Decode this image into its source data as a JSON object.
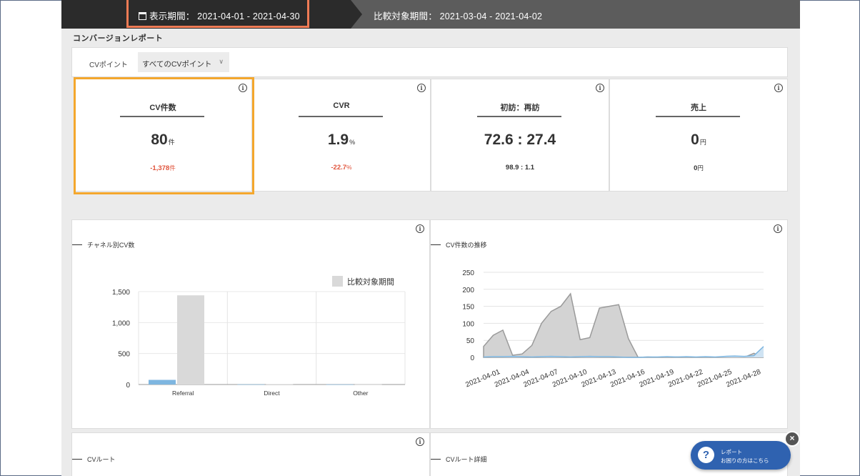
{
  "header": {
    "display_period": "表示期間： 2021-04-01 - 2021-04-30",
    "comparison_period": "比較対象期間： 2021-03-04 - 2021-04-02"
  },
  "page_title": "コンバージョンレポート",
  "filter": {
    "label": "CVポイント",
    "selected": "すべてのCVポイント"
  },
  "metrics": [
    {
      "label": "CV件数",
      "value": "80",
      "unit": "件",
      "diff": "-1,378",
      "diff_unit": "件",
      "diff_negative": true
    },
    {
      "label": "CVR",
      "value": "1.9",
      "unit": "%",
      "diff": "-22.7",
      "diff_unit": "%",
      "diff_negative": true
    },
    {
      "label": "初訪：再訪",
      "value": "72.6 : 27.4",
      "unit": "",
      "diff": "98.9 : 1.1",
      "diff_unit": "",
      "diff_negative": false
    },
    {
      "label": "売上",
      "value": "0",
      "unit": "円",
      "diff": "0",
      "diff_unit": "円",
      "diff_negative": false
    }
  ],
  "panels": {
    "channel_title": "チャネル別CV数",
    "trend_title": "CV件数の推移",
    "route_title": "CVルート",
    "route_detail_title": "CVルート詳細"
  },
  "help_button": {
    "line1": "レポート",
    "line2": "お困りの方はこちら"
  },
  "colors": {
    "current": "#7eb6e0",
    "comparison": "#d9d9d9",
    "negative": "#e0533b",
    "highlight_orange": "#f4a72d",
    "highlight_red": "#ef7b55"
  },
  "chart_data": [
    {
      "type": "bar",
      "categories": [
        "Referral",
        "Direct",
        "Other"
      ],
      "series": [
        {
          "values": [
            75,
            3,
            2
          ]
        },
        {
          "name": "比較対象期間",
          "values": [
            1440,
            5,
            3
          ]
        }
      ],
      "yticks": [
        "0",
        "500",
        "1,000",
        "1,500"
      ],
      "ylim": [
        0,
        1500
      ],
      "legend": "top-right"
    },
    {
      "type": "area",
      "x": [
        "2021-04-01",
        "2021-04-02",
        "2021-04-03",
        "2021-04-04",
        "2021-04-05",
        "2021-04-06",
        "2021-04-07",
        "2021-04-08",
        "2021-04-09",
        "2021-04-10",
        "2021-04-11",
        "2021-04-12",
        "2021-04-13",
        "2021-04-14",
        "2021-04-15",
        "2021-04-16",
        "2021-04-17",
        "2021-04-18",
        "2021-04-19",
        "2021-04-20",
        "2021-04-21",
        "2021-04-22",
        "2021-04-23",
        "2021-04-24",
        "2021-04-25",
        "2021-04-26",
        "2021-04-27",
        "2021-04-28",
        "2021-04-29",
        "2021-04-30"
      ],
      "xticks": [
        "2021-04-01",
        "2021-04-04",
        "2021-04-07",
        "2021-04-10",
        "2021-04-13",
        "2021-04-16",
        "2021-04-19",
        "2021-04-22",
        "2021-04-25",
        "2021-04-28"
      ],
      "series": [
        {
          "values": [
            1,
            2,
            2,
            3,
            2,
            1,
            2,
            3,
            2,
            1,
            2,
            3,
            2,
            2,
            1,
            0,
            0,
            1,
            1,
            2,
            1,
            2,
            1,
            2,
            1,
            3,
            4,
            3,
            5,
            32
          ]
        },
        {
          "values": [
            32,
            65,
            80,
            6,
            10,
            35,
            100,
            135,
            150,
            187,
            52,
            58,
            145,
            150,
            155,
            55,
            0,
            1,
            0,
            0,
            1,
            0,
            0,
            1,
            0,
            0,
            1,
            0,
            12,
            0
          ]
        }
      ],
      "yticks": [
        0,
        50,
        100,
        150,
        200,
        250
      ],
      "ylim": [
        0,
        250
      ]
    }
  ]
}
